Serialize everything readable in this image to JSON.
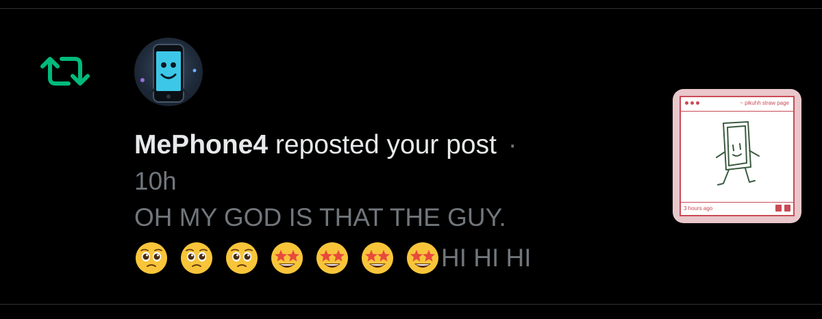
{
  "notification": {
    "user_name": "MePhone4",
    "action_text": "reposted your post",
    "separator": "·",
    "timestamp": "10h",
    "post_text_line1": "OH MY GOD IS THAT THE GUY.",
    "post_text_tail": "HI HI HI",
    "emojis": [
      "pleading-face",
      "pleading-face",
      "pleading-face",
      "star-struck",
      "star-struck",
      "star-struck",
      "star-struck"
    ],
    "repost_icon": "repost-icon",
    "avatar_icon": "phone-character-avatar"
  },
  "thumbnail": {
    "window_title": "~ pikuhh straw page",
    "time_ago": "3 hours ago",
    "save_icon": "save-icon",
    "delete_icon": "trash-icon"
  },
  "colors": {
    "background": "#000000",
    "primary_text": "#e7e9ea",
    "secondary_text": "#71767b",
    "repost_green": "#00ba7c",
    "divider": "#2f3336",
    "thumbnail_accent": "#c94a55"
  }
}
